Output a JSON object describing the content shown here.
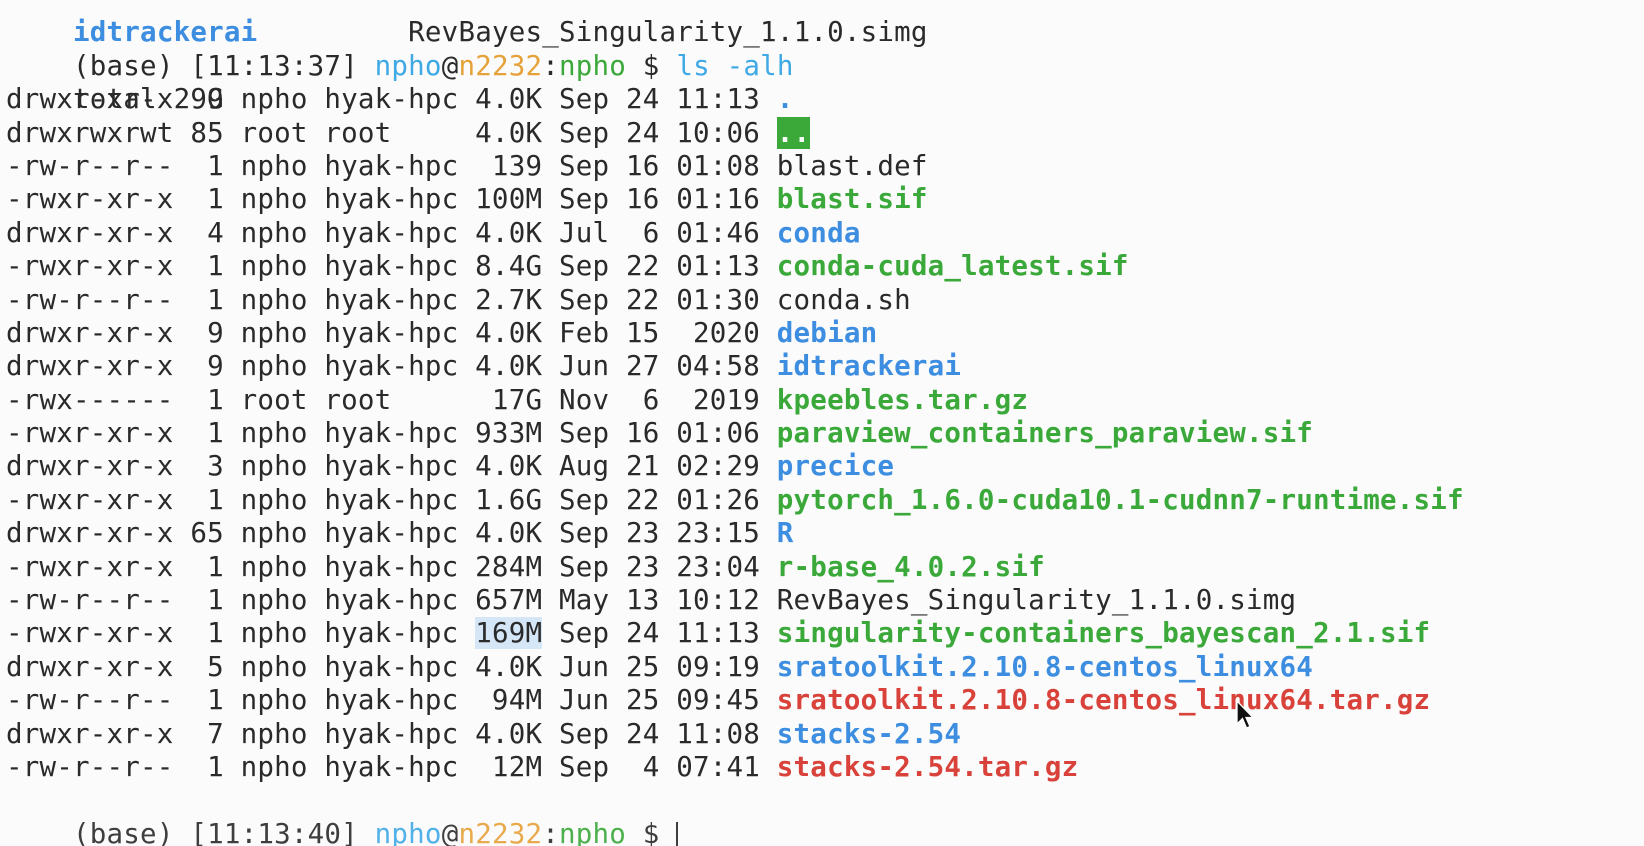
{
  "top_line": {
    "left": "idtrackerai",
    "gap": "         ",
    "right": "RevBayes_Singularity_1.1.0.simg"
  },
  "prompt": {
    "env": "(base) ",
    "time": "[11:13:37] ",
    "user": "npho",
    "at": "@",
    "host": "n2232",
    "colon": ":",
    "path": "npho",
    "dollar": " $ ",
    "command": "ls -alh"
  },
  "total": "total 29G",
  "rows": [
    {
      "meta": "drwxr-xr-x  9 npho hyak-hpc 4.0K Sep 24 11:13 ",
      "name": ".",
      "style": "blue"
    },
    {
      "meta": "drwxrwxrwt 85 root root     4.0K Sep 24 10:06 ",
      "name": "..",
      "style": "bggreen"
    },
    {
      "meta": "-rw-r--r--  1 npho hyak-hpc  139 Sep 16 01:08 ",
      "name": "blast.def",
      "style": "plain"
    },
    {
      "meta": "-rwxr-xr-x  1 npho hyak-hpc 100M Sep 16 01:16 ",
      "name": "blast.sif",
      "style": "green"
    },
    {
      "meta": "drwxr-xr-x  4 npho hyak-hpc 4.0K Jul  6 01:46 ",
      "name": "conda",
      "style": "blue"
    },
    {
      "meta": "-rwxr-xr-x  1 npho hyak-hpc 8.4G Sep 22 01:13 ",
      "name": "conda-cuda_latest.sif",
      "style": "green"
    },
    {
      "meta": "-rw-r--r--  1 npho hyak-hpc 2.7K Sep 22 01:30 ",
      "name": "conda.sh",
      "style": "plain"
    },
    {
      "meta": "drwxr-xr-x  9 npho hyak-hpc 4.0K Feb 15  2020 ",
      "name": "debian",
      "style": "blue"
    },
    {
      "meta": "drwxr-xr-x  9 npho hyak-hpc 4.0K Jun 27 04:58 ",
      "name": "idtrackerai",
      "style": "blue"
    },
    {
      "meta": "-rwx------  1 root root      17G Nov  6  2019 ",
      "name": "kpeebles.tar.gz",
      "style": "green"
    },
    {
      "meta": "-rwxr-xr-x  1 npho hyak-hpc 933M Sep 16 01:06 ",
      "name": "paraview_containers_paraview.sif",
      "style": "green"
    },
    {
      "meta": "drwxr-xr-x  3 npho hyak-hpc 4.0K Aug 21 02:29 ",
      "name": "precice",
      "style": "blue"
    },
    {
      "meta": "-rwxr-xr-x  1 npho hyak-hpc 1.6G Sep 22 01:26 ",
      "name": "pytorch_1.6.0-cuda10.1-cudnn7-runtime.sif",
      "style": "green"
    },
    {
      "meta": "drwxr-xr-x 65 npho hyak-hpc 4.0K Sep 23 23:15 ",
      "name": "R",
      "style": "blue"
    },
    {
      "meta": "-rwxr-xr-x  1 npho hyak-hpc 284M Sep 23 23:04 ",
      "name": "r-base_4.0.2.sif",
      "style": "green"
    },
    {
      "meta": "-rw-r--r--  1 npho hyak-hpc 657M May 13 10:12 ",
      "name": "RevBayes_Singularity_1.1.0.simg",
      "style": "plain"
    },
    {
      "meta_pre": "-rwxr-xr-x  1 npho hyak-hpc ",
      "meta_sel": "169M",
      "meta_post": " Sep 24 11:13 ",
      "name": "singularity-containers_bayescan_2.1.sif",
      "style": "green"
    },
    {
      "meta": "drwxr-xr-x  5 npho hyak-hpc 4.0K Jun 25 09:19 ",
      "name": "sratoolkit.2.10.8-centos_linux64",
      "style": "blue"
    },
    {
      "meta": "-rw-r--r--  1 npho hyak-hpc  94M Jun 25 09:45 ",
      "name": "sratoolkit.2.10.8-centos_linux64.tar.gz",
      "style": "red"
    },
    {
      "meta": "drwxr-xr-x  7 npho hyak-hpc 4.0K Sep 24 11:08 ",
      "name": "stacks-2.54",
      "style": "blue"
    },
    {
      "meta": "-rw-r--r--  1 npho hyak-hpc  12M Sep  4 07:41 ",
      "name": "stacks-2.54.tar.gz",
      "style": "red"
    }
  ],
  "next_prompt": {
    "env": "(base) ",
    "time": "[11:13:40] ",
    "user": "npho",
    "at": "@",
    "host": "n2232",
    "colon": ":",
    "path": "npho",
    "dollar": " $ "
  },
  "colors": {
    "background": "#fbfbfb",
    "directory": "#3d8ee0",
    "executable": "#3aa93a",
    "archive": "#d9423a",
    "host": "#e6a23a",
    "user": "#3fa9e6"
  },
  "icons": {
    "mouse_pointer": "arrow-cursor-icon"
  }
}
